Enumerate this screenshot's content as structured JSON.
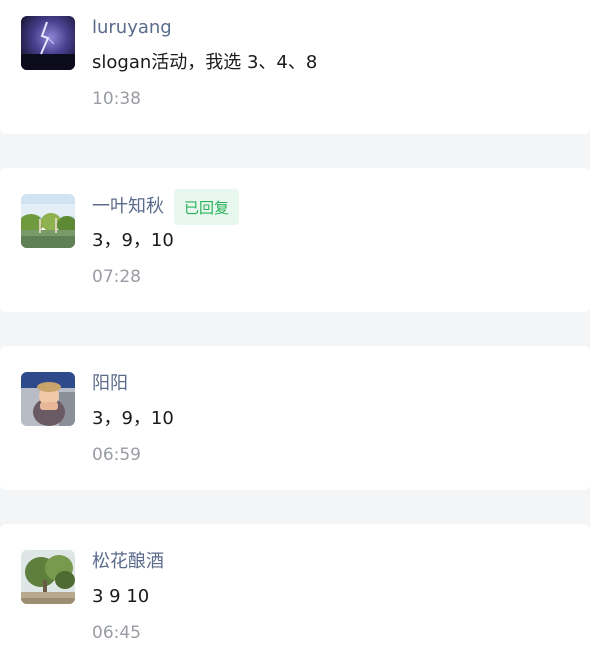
{
  "comments": [
    {
      "avatar_icon": "lightning-storm-avatar",
      "name": "luruyang",
      "badge": "",
      "content": "slogan活动，我选 3、4、8",
      "time": "10:38"
    },
    {
      "avatar_icon": "lake-trees-avatar",
      "name": "一叶知秋",
      "badge": "已回复",
      "content": "3，9，10",
      "time": "07:28"
    },
    {
      "avatar_icon": "person-photo-avatar",
      "name": "阳阳",
      "badge": "",
      "content": "3，9，10",
      "time": "06:59"
    },
    {
      "avatar_icon": "tree-landscape-avatar",
      "name": "松花酿酒",
      "badge": "",
      "content": "3 9 10",
      "time": "06:45"
    }
  ],
  "colors": {
    "name": "#5b6b8c",
    "badge_bg": "#e8f8ee",
    "badge_text": "#2bb35a",
    "time": "#999ca3",
    "background": "#f4f5f7"
  }
}
